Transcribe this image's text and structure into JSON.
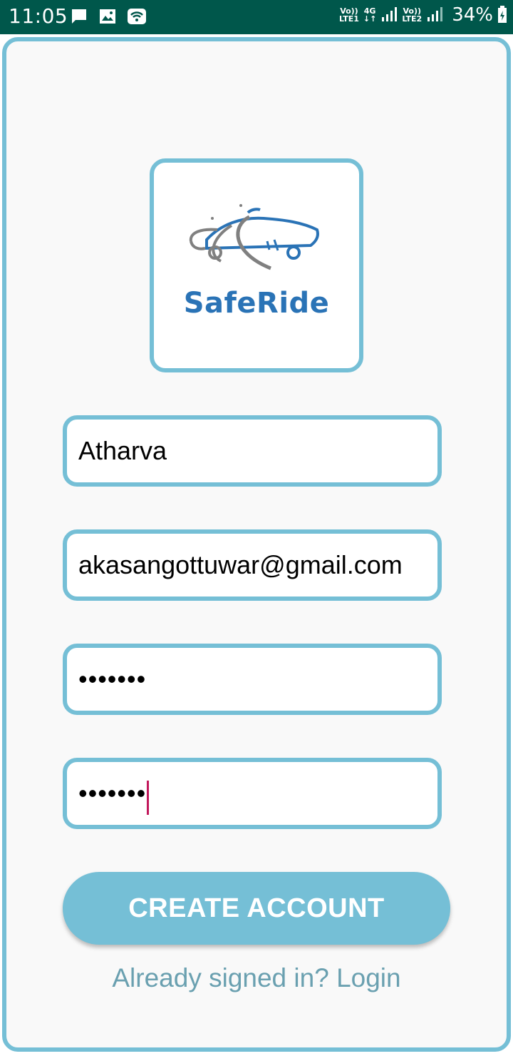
{
  "status_bar": {
    "time": "11:05",
    "sim1_label_top": "Vo))",
    "sim1_label_bottom": "LTE1",
    "network_type": "4G",
    "sim2_label_top": "Vo))",
    "sim2_label_bottom": "LTE2",
    "battery": "34%",
    "icons": [
      "message-icon",
      "image-icon",
      "wifi-icon",
      "signal-icon",
      "battery-icon"
    ]
  },
  "logo": {
    "text": "SafeRide",
    "brand_color": "#2a73b6"
  },
  "form": {
    "name_value": "Atharva",
    "email_value": "akasangottuwar@gmail.com",
    "password_value": "•••••••",
    "confirm_password_value": "•••••••"
  },
  "actions": {
    "create_account_label": "CREATE ACCOUNT",
    "login_link_label": "Already signed in? Login"
  },
  "colors": {
    "accent": "#75bfd6",
    "status_bar": "#00574b",
    "caret": "#c2185b"
  }
}
